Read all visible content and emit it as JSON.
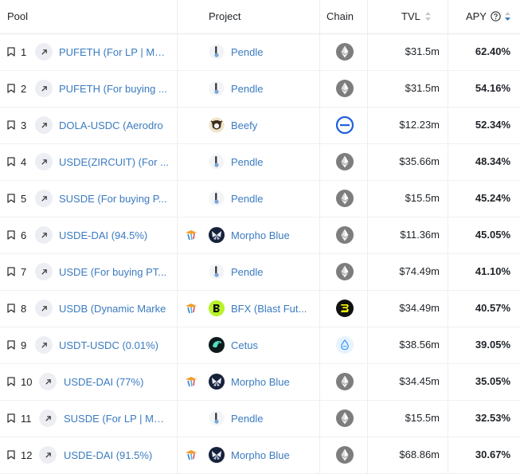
{
  "header": {
    "pool": "Pool",
    "project": "Project",
    "chain": "Chain",
    "tvl": "TVL",
    "apy": "APY"
  },
  "colors": {
    "link": "#3b7bc0",
    "eth_bg": "#7d7d7d",
    "base_blue": "#1f5fe0"
  },
  "rows": [
    {
      "rank": "1",
      "pool": "PUFETH (For LP | Ma...",
      "project": "Pendle",
      "project_icon": "pendle-icon",
      "chain_icon": "ethereum-icon",
      "tvl": "$31.5m",
      "apy": "62.40%",
      "yield": false
    },
    {
      "rank": "2",
      "pool": "PUFETH (For buying ...",
      "project": "Pendle",
      "project_icon": "pendle-icon",
      "chain_icon": "ethereum-icon",
      "tvl": "$31.5m",
      "apy": "54.16%",
      "yield": false
    },
    {
      "rank": "3",
      "pool": "DOLA-USDC (Aerodro",
      "project": "Beefy",
      "project_icon": "beefy-icon",
      "chain_icon": "base-icon",
      "tvl": "$12.23m",
      "apy": "52.34%",
      "yield": false
    },
    {
      "rank": "4",
      "pool": "USDE(ZIRCUIT) (For ...",
      "project": "Pendle",
      "project_icon": "pendle-icon",
      "chain_icon": "ethereum-icon",
      "tvl": "$35.66m",
      "apy": "48.34%",
      "yield": false
    },
    {
      "rank": "5",
      "pool": "SUSDE (For buying P...",
      "project": "Pendle",
      "project_icon": "pendle-icon",
      "chain_icon": "ethereum-icon",
      "tvl": "$15.5m",
      "apy": "45.24%",
      "yield": false
    },
    {
      "rank": "6",
      "pool": "USDE-DAI (94.5%)",
      "project": "Morpho Blue",
      "project_icon": "morpho-icon",
      "chain_icon": "ethereum-icon",
      "tvl": "$11.36m",
      "apy": "45.05%",
      "yield": true
    },
    {
      "rank": "7",
      "pool": "USDE (For buying PT...",
      "project": "Pendle",
      "project_icon": "pendle-icon",
      "chain_icon": "ethereum-icon",
      "tvl": "$74.49m",
      "apy": "41.10%",
      "yield": false
    },
    {
      "rank": "8",
      "pool": "USDB (Dynamic Marke",
      "project": "BFX (Blast Fut...",
      "project_icon": "bfx-icon",
      "chain_icon": "blast-icon",
      "tvl": "$34.49m",
      "apy": "40.57%",
      "yield": true
    },
    {
      "rank": "9",
      "pool": "USDT-USDC (0.01%)",
      "project": "Cetus",
      "project_icon": "cetus-icon",
      "chain_icon": "sui-icon",
      "tvl": "$38.56m",
      "apy": "39.05%",
      "yield": false
    },
    {
      "rank": "10",
      "pool": "USDE-DAI (77%)",
      "project": "Morpho Blue",
      "project_icon": "morpho-icon",
      "chain_icon": "ethereum-icon",
      "tvl": "$34.45m",
      "apy": "35.05%",
      "yield": true
    },
    {
      "rank": "11",
      "pool": "SUSDE (For LP | Mat...",
      "project": "Pendle",
      "project_icon": "pendle-icon",
      "chain_icon": "ethereum-icon",
      "tvl": "$15.5m",
      "apy": "32.53%",
      "yield": false
    },
    {
      "rank": "12",
      "pool": "USDE-DAI (91.5%)",
      "project": "Morpho Blue",
      "project_icon": "morpho-icon",
      "chain_icon": "ethereum-icon",
      "tvl": "$68.86m",
      "apy": "30.67%",
      "yield": true
    }
  ]
}
